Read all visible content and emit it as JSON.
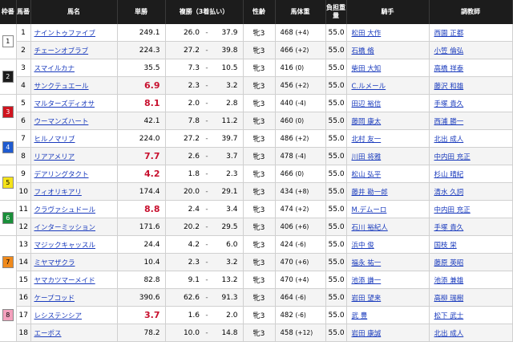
{
  "headers": {
    "waku": "枠番",
    "umaban": "馬番",
    "name": "馬名",
    "win": "単勝",
    "place": "複勝（3着払い）",
    "sexage": "性齢",
    "weight": "馬体重",
    "burden": "負担重量",
    "jockey": "騎手",
    "trainer": "調教師"
  },
  "waku_colors": {
    "1": {
      "bg": "#ffffff",
      "fg": "#000000"
    },
    "2": {
      "bg": "#1c1c1c",
      "fg": "#ffffff"
    },
    "3": {
      "bg": "#d0141e",
      "fg": "#ffffff"
    },
    "4": {
      "bg": "#1f5bd0",
      "fg": "#ffffff"
    },
    "5": {
      "bg": "#f5e31a",
      "fg": "#000000"
    },
    "6": {
      "bg": "#1a8f3a",
      "fg": "#ffffff"
    },
    "7": {
      "bg": "#f08a1c",
      "fg": "#000000"
    },
    "8": {
      "bg": "#f4a0bd",
      "fg": "#000000"
    }
  },
  "rows": [
    {
      "waku": "1",
      "num": "1",
      "name": "ナイントゥファイブ",
      "win": "249.1",
      "fav": false,
      "plo": "26.0",
      "phi": "37.9",
      "sa": "牝3",
      "w": "468",
      "wd": "(+4)",
      "kg": "55.0",
      "jockey": "松田 大作",
      "trainer": "西園 正都"
    },
    {
      "waku": "1",
      "num": "2",
      "name": "チェーンオブラブ",
      "win": "224.3",
      "fav": false,
      "plo": "27.2",
      "phi": "39.8",
      "sa": "牝3",
      "w": "466",
      "wd": "(+2)",
      "kg": "55.0",
      "jockey": "石橋 脩",
      "trainer": "小笠 倫弘"
    },
    {
      "waku": "2",
      "num": "3",
      "name": "スマイルカナ",
      "win": "35.5",
      "fav": false,
      "plo": "7.3",
      "phi": "10.5",
      "sa": "牝3",
      "w": "416",
      "wd": "(0)",
      "kg": "55.0",
      "jockey": "柴田 大知",
      "trainer": "高橋 祥泰"
    },
    {
      "waku": "2",
      "num": "4",
      "name": "サンクテュエール",
      "win": "6.9",
      "fav": true,
      "plo": "2.3",
      "phi": "3.2",
      "sa": "牝3",
      "w": "456",
      "wd": "(+2)",
      "kg": "55.0",
      "jockey": "C.ルメール",
      "trainer": "藤沢 和雄"
    },
    {
      "waku": "3",
      "num": "5",
      "name": "マルターズディオサ",
      "win": "8.1",
      "fav": true,
      "plo": "2.0",
      "phi": "2.8",
      "sa": "牝3",
      "w": "440",
      "wd": "(-4)",
      "kg": "55.0",
      "jockey": "田辺 裕信",
      "trainer": "手塚 貴久"
    },
    {
      "waku": "3",
      "num": "6",
      "name": "ウーマンズハート",
      "win": "42.1",
      "fav": false,
      "plo": "7.8",
      "phi": "11.2",
      "sa": "牝3",
      "w": "460",
      "wd": "(0)",
      "kg": "55.0",
      "jockey": "藤岡 康太",
      "trainer": "西浦 勝一"
    },
    {
      "waku": "4",
      "num": "7",
      "name": "ヒルノマリブ",
      "win": "224.0",
      "fav": false,
      "plo": "27.2",
      "phi": "39.7",
      "sa": "牝3",
      "w": "486",
      "wd": "(+2)",
      "kg": "55.0",
      "jockey": "北村 友一",
      "trainer": "北出 成人"
    },
    {
      "waku": "4",
      "num": "8",
      "name": "リアアメリア",
      "win": "7.7",
      "fav": true,
      "plo": "2.6",
      "phi": "3.7",
      "sa": "牝3",
      "w": "478",
      "wd": "(-4)",
      "kg": "55.0",
      "jockey": "川田 将雅",
      "trainer": "中内田 充正"
    },
    {
      "waku": "5",
      "num": "9",
      "name": "デアリングタクト",
      "win": "4.2",
      "fav": true,
      "plo": "1.8",
      "phi": "2.3",
      "sa": "牝3",
      "w": "466",
      "wd": "(0)",
      "kg": "55.0",
      "jockey": "松山 弘平",
      "trainer": "杉山 晴紀"
    },
    {
      "waku": "5",
      "num": "10",
      "name": "フィオリキアリ",
      "win": "174.4",
      "fav": false,
      "plo": "20.0",
      "phi": "29.1",
      "sa": "牝3",
      "w": "434",
      "wd": "(+8)",
      "kg": "55.0",
      "jockey": "藤井 勘一郎",
      "trainer": "清水 久詞"
    },
    {
      "waku": "6",
      "num": "11",
      "name": "クラヴァシュドール",
      "win": "8.8",
      "fav": true,
      "plo": "2.4",
      "phi": "3.4",
      "sa": "牝3",
      "w": "474",
      "wd": "(+2)",
      "kg": "55.0",
      "jockey": "M.デムーロ",
      "trainer": "中内田 充正"
    },
    {
      "waku": "6",
      "num": "12",
      "name": "インターミッション",
      "win": "171.6",
      "fav": false,
      "plo": "20.2",
      "phi": "29.5",
      "sa": "牝3",
      "w": "406",
      "wd": "(+6)",
      "kg": "55.0",
      "jockey": "石川 裕紀人",
      "trainer": "手塚 貴久"
    },
    {
      "waku": "7",
      "num": "13",
      "name": "マジックキャッスル",
      "win": "24.4",
      "fav": false,
      "plo": "4.2",
      "phi": "6.0",
      "sa": "牝3",
      "w": "424",
      "wd": "(-6)",
      "kg": "55.0",
      "jockey": "浜中 俊",
      "trainer": "国枝 栄"
    },
    {
      "waku": "7",
      "num": "14",
      "name": "ミヤマザクラ",
      "win": "10.4",
      "fav": false,
      "plo": "2.3",
      "phi": "3.2",
      "sa": "牝3",
      "w": "470",
      "wd": "(+6)",
      "kg": "55.0",
      "jockey": "福永 祐一",
      "trainer": "藤原 英昭"
    },
    {
      "waku": "7",
      "num": "15",
      "name": "ヤマカツマーメイド",
      "win": "82.8",
      "fav": false,
      "plo": "9.1",
      "phi": "13.2",
      "sa": "牝3",
      "w": "470",
      "wd": "(+4)",
      "kg": "55.0",
      "jockey": "池添 謙一",
      "trainer": "池添 兼雄"
    },
    {
      "waku": "8",
      "num": "16",
      "name": "ケープコッド",
      "win": "390.6",
      "fav": false,
      "plo": "62.6",
      "phi": "91.3",
      "sa": "牝3",
      "w": "464",
      "wd": "(-6)",
      "kg": "55.0",
      "jockey": "岩田 望来",
      "trainer": "高柳 瑞樹"
    },
    {
      "waku": "8",
      "num": "17",
      "name": "レシステンシア",
      "win": "3.7",
      "fav": true,
      "plo": "1.6",
      "phi": "2.0",
      "sa": "牝3",
      "w": "482",
      "wd": "(-6)",
      "kg": "55.0",
      "jockey": "武 豊",
      "trainer": "松下 武士"
    },
    {
      "waku": "8",
      "num": "18",
      "name": "エーポス",
      "win": "78.2",
      "fav": false,
      "plo": "10.0",
      "phi": "14.8",
      "sa": "牝3",
      "w": "458",
      "wd": "(+12)",
      "kg": "55.0",
      "jockey": "岩田 康誠",
      "trainer": "北出 成人"
    }
  ]
}
